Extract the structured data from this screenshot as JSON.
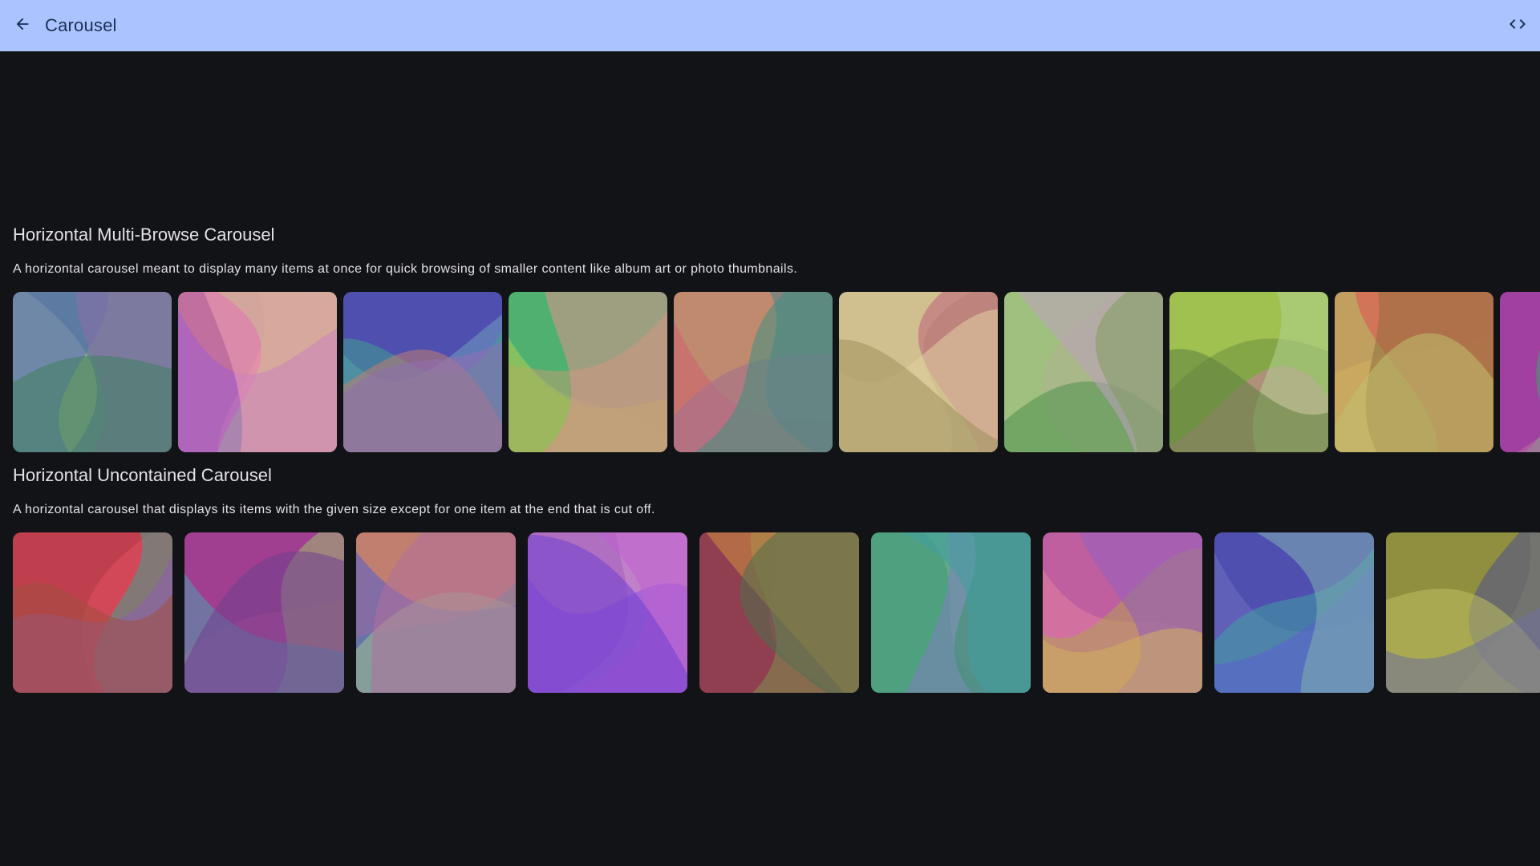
{
  "header": {
    "title": "Carousel",
    "back_icon": "arrow-back-icon",
    "code_icon": "code-icon"
  },
  "sections": [
    {
      "title": "Horizontal Multi-Browse Carousel",
      "description": "A horizontal carousel meant to display many items at once for quick browsing of smaller content like album art or photo thumbnails.",
      "items": [
        {
          "colors": [
            "#6f88a8",
            "#a9c46f",
            "#4f6f9f",
            "#8a6fa8",
            "#3f7f5f"
          ]
        },
        {
          "colors": [
            "#c06f9f",
            "#e08a9a",
            "#9fe06f",
            "#a05fd0",
            "#f0a0b0"
          ]
        },
        {
          "colors": [
            "#4f4fb0",
            "#6f9fc0",
            "#3fa08f",
            "#c0806f",
            "#8f6fb0"
          ]
        },
        {
          "colors": [
            "#4fb06f",
            "#7fd06f",
            "#c09f6f",
            "#a0c050",
            "#e08f8f"
          ]
        },
        {
          "colors": [
            "#c08a6f",
            "#d0606f",
            "#4f7f8f",
            "#a06f8f",
            "#3f8f7f"
          ]
        },
        {
          "colors": [
            "#d0c08f",
            "#b0a06f",
            "#c05f7f",
            "#e0d0a0",
            "#9f8f5f"
          ]
        },
        {
          "colors": [
            "#a0c07f",
            "#b0b090",
            "#4f8f4f",
            "#c0a0c0",
            "#7f9f5f"
          ]
        },
        {
          "colors": [
            "#a0c050",
            "#6f8f3f",
            "#d080a0",
            "#b0d08f",
            "#5f7f3f"
          ]
        },
        {
          "colors": [
            "#c09f5f",
            "#d0b060",
            "#e05050",
            "#8f6f3f",
            "#c0c070"
          ]
        },
        {
          "colors": [
            "#a040a0",
            "#50c080",
            "#7f5fc0",
            "#c06fa0",
            "#3fa070"
          ]
        }
      ]
    },
    {
      "title": "Horizontal Uncontained Carousel",
      "description": "A horizontal carousel that displays its items with the given size except for one item at the end that is cut off.",
      "items": [
        {
          "colors": [
            "#c03f4f",
            "#e05060",
            "#3fa08f",
            "#8f5fb0",
            "#a04f3f"
          ]
        },
        {
          "colors": [
            "#a03f8f",
            "#c0508f",
            "#9fc06f",
            "#4f9fb0",
            "#6f3f8f"
          ]
        },
        {
          "colors": [
            "#c07f6f",
            "#4f9f8f",
            "#4f5fd0",
            "#a0c08f",
            "#b06f9f"
          ]
        },
        {
          "colors": [
            "#b06fc0",
            "#d08fd0",
            "#8f50e0",
            "#c060d0",
            "#7040d0"
          ]
        },
        {
          "colors": [
            "#8f3f4f",
            "#c03f5f",
            "#7f8f4f",
            "#d08f3f",
            "#4f6f4f"
          ]
        },
        {
          "colors": [
            "#4fa07f",
            "#6fb08f",
            "#7f7fc0",
            "#3f8f6f",
            "#3f9fa0"
          ]
        },
        {
          "colors": [
            "#c05f9f",
            "#e080a0",
            "#b0a050",
            "#8f5fc0",
            "#d0b060"
          ]
        },
        {
          "colors": [
            "#4f4fb0",
            "#6f6fc0",
            "#3fa0a0",
            "#5f5fd0",
            "#7fb0b0"
          ]
        },
        {
          "colors": [
            "#8f8f3f",
            "#b0b050",
            "#4f4f8f",
            "#c0c060",
            "#6f6f9f"
          ]
        }
      ]
    }
  ]
}
